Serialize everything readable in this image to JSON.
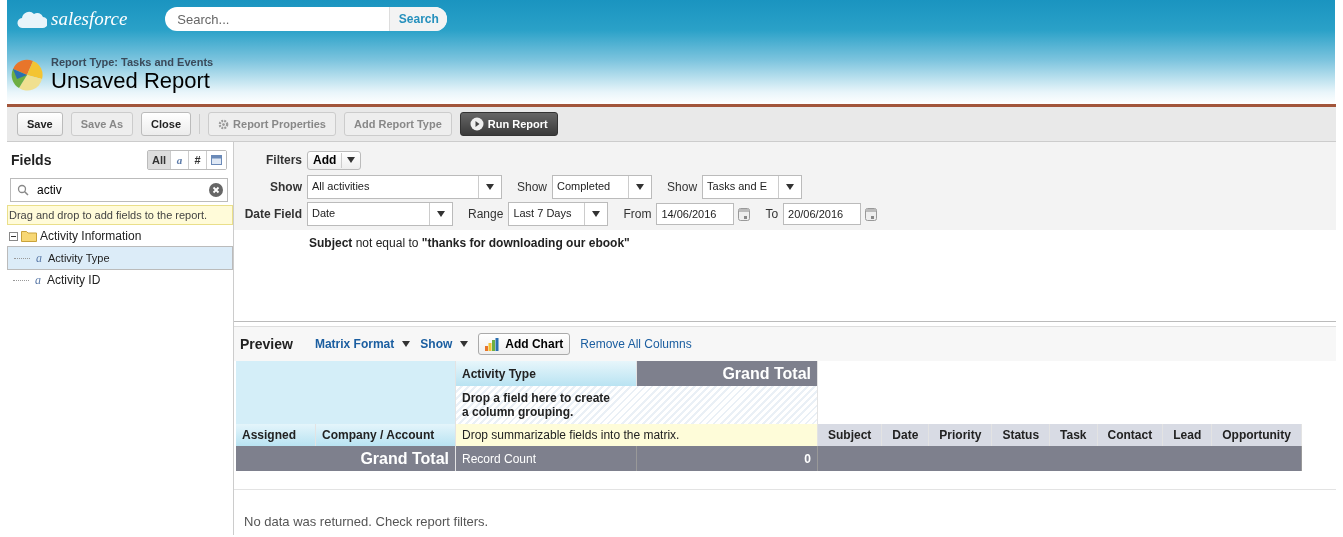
{
  "header": {
    "logo_text": "salesforce",
    "search": {
      "placeholder": "Search..."
    },
    "search_button": "Search"
  },
  "page": {
    "report_type": "Report Type: Tasks and Events",
    "title": "Unsaved Report"
  },
  "toolbar": [
    {
      "label": "Save",
      "kind": "plain",
      "disabled": false
    },
    {
      "label": "Save As",
      "kind": "plain",
      "disabled": true
    },
    {
      "label": "Close",
      "kind": "plain",
      "disabled": false
    },
    {
      "label": "Report Properties",
      "kind": "gear",
      "disabled": true
    },
    {
      "label": "Add Report Type",
      "kind": "plain",
      "disabled": true
    },
    {
      "label": "Run Report",
      "kind": "run",
      "disabled": false
    }
  ],
  "fields_panel": {
    "title": "Fields",
    "filter_buttons": [
      {
        "kind": "all",
        "label": "All",
        "selected": true
      },
      {
        "kind": "text",
        "label": "a",
        "selected": false
      },
      {
        "kind": "number",
        "label": "#",
        "selected": false
      },
      {
        "kind": "date",
        "selected": false
      }
    ],
    "search": {
      "value": "activ"
    },
    "hint": "Drag and drop to add fields to the report.",
    "tree": [
      {
        "label": "Activity Information",
        "expanded": true,
        "selected": false,
        "children": [
          {
            "icon": "a",
            "label": "Activity Type",
            "selected": true
          },
          {
            "icon": "a",
            "label": "Activity ID",
            "selected": false
          }
        ]
      }
    ]
  },
  "filters": {
    "label": "Filters",
    "add_button": "Add",
    "rows": [
      [
        {
          "label": "Show",
          "value": "All activities",
          "kind": "select"
        },
        {
          "label": "Show",
          "value": "Completed",
          "kind": "select"
        },
        {
          "label": "Show",
          "value": "Tasks and E",
          "kind": "select"
        }
      ],
      [
        {
          "label": "Date Field",
          "value": "Date",
          "kind": "select"
        },
        {
          "label": "Range",
          "value": "Last 7 Days",
          "kind": "select"
        },
        {
          "label": "From",
          "value": "14/06/2016",
          "kind": "date"
        },
        {
          "label": "To",
          "value": "20/06/2016",
          "kind": "date"
        }
      ]
    ],
    "criteria": "**Subject** not equal to **\"thanks for downloading our ebook\"**"
  },
  "preview": {
    "title": "Preview",
    "format_menu": "Matrix Format",
    "show_menu": "Show",
    "add_chart": "Add Chart",
    "remove_columns": "Remove All Columns"
  },
  "matrix": {
    "column_grouping": "Activity Type",
    "grand_total_header": "Grand Total",
    "column_drop_hint": "Drop a field here to create a column grouping.",
    "row_groupings": [
      "Assigned",
      "Company / Account"
    ],
    "summary_hint": "Drop summarizable fields into the matrix.",
    "detail_columns": [
      "Subject",
      "Date",
      "Priority",
      "Status",
      "Task",
      "Contact",
      "Lead",
      "Opportunity"
    ],
    "grand_total_label": "Grand Total",
    "record_count_label": "Record Count",
    "record_count": "0"
  },
  "no_data": "No data was returned. Check report filters."
}
